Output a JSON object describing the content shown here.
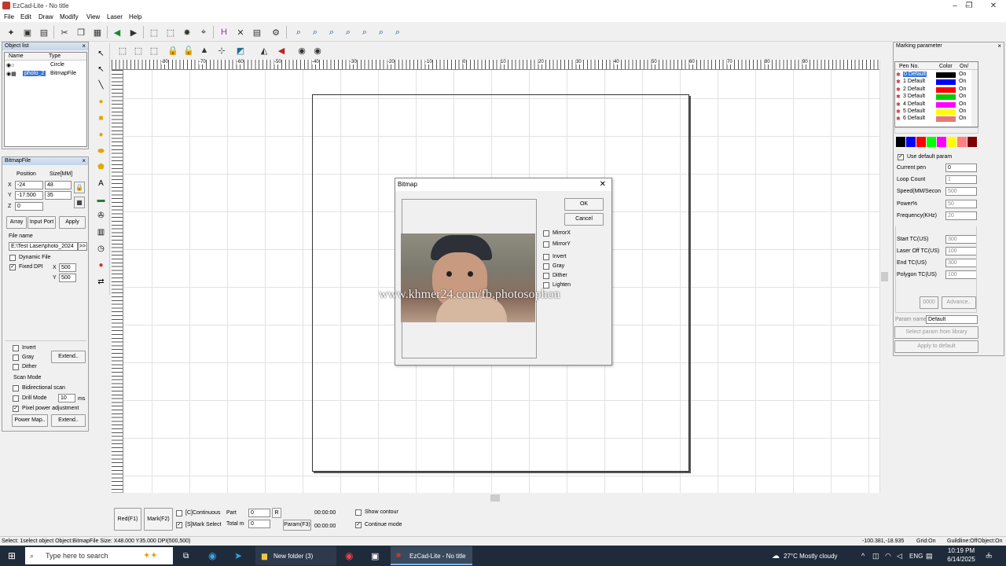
{
  "window": {
    "title": "EzCad-Lite - No title",
    "minimize": "–",
    "maximize": "❐",
    "close": "✕"
  },
  "menu": [
    "File",
    "Edit",
    "Draw",
    "Modify",
    "View",
    "Laser",
    "Help"
  ],
  "object_list": {
    "title": "Object list",
    "col_name": "Name",
    "col_type": "Type",
    "rows": [
      {
        "name": "",
        "type": "Circle"
      },
      {
        "name": "photo_2",
        "type": "BitmapFile"
      }
    ]
  },
  "bitmap_panel": {
    "title": "BitmapFile",
    "position_label": "Position",
    "size_label": "Size[MM]",
    "x_label": "X",
    "y_label": "Y",
    "z_label": "Z",
    "x_pos": "-24",
    "y_pos": "-17.500",
    "z_pos": "0",
    "width": "48",
    "height": "35",
    "array_btn": "Array",
    "input_port_btn": "Input Port",
    "apply_btn": "Apply",
    "file_name_label": "File name",
    "file_name": "E:\\Test Laser\\photo_2024",
    "browse_btn": ">>",
    "dynamic_file": "Dynamic File",
    "fixed_dpi": "Fixed DPI",
    "dpi_x": "500",
    "dpi_y": "500",
    "invert": "Invert",
    "gray": "Gray",
    "dither": "Dither",
    "extend_btn": "Extend..",
    "scan_mode": "Scan Mode",
    "bidirectional": "Bidirectional scan",
    "drill_mode": "Drill Mode",
    "drill_value": "10",
    "drill_unit": "ms",
    "pixel_power": "Pixel power adjustment",
    "power_map_btn": "Power Map..",
    "extend_btn2": "Extend.."
  },
  "ruler_labels": [
    "-80",
    "-70",
    "-60",
    "-50",
    "-40",
    "-30",
    "-20",
    "-10",
    "0",
    "10",
    "20",
    "30",
    "40",
    "50",
    "60",
    "70",
    "80",
    "90"
  ],
  "bitmap_dialog": {
    "title": "Bitmap",
    "ok": "OK",
    "cancel": "Cancel",
    "mirror_x": "MirrorX",
    "mirror_y": "MirrorY",
    "invert": "Invert",
    "gray": "Gray",
    "dither": "Dither",
    "lighten": "Lighten",
    "watermark": "www.khmer24.com/fb.photosophon"
  },
  "marking": {
    "title": "Marking parameter",
    "col_pen": "Pen No.",
    "col_color": "Color",
    "col_on": "On/",
    "pens": [
      {
        "name": "0 Default",
        "color": "#000000",
        "on": "On"
      },
      {
        "name": "1 Default",
        "color": "#0000ff",
        "on": "On"
      },
      {
        "name": "2 Default",
        "color": "#ff0000",
        "on": "On"
      },
      {
        "name": "3 Default",
        "color": "#00cc00",
        "on": "On"
      },
      {
        "name": "4 Default",
        "color": "#ff00ff",
        "on": "On"
      },
      {
        "name": "5 Default",
        "color": "#ffff00",
        "on": "On"
      },
      {
        "name": "6 Default",
        "color": "#e87878",
        "on": "On"
      }
    ],
    "palette": [
      "#000000",
      "#0000ff",
      "#ff0000",
      "#00ff00",
      "#ff00ff",
      "#ffff00",
      "#ff8080",
      "#800000"
    ],
    "use_default": "Use default param",
    "current_pen_label": "Current pen",
    "current_pen": "0",
    "loop_count_label": "Loop Count",
    "loop_count": "1",
    "speed_label": "Speed(MM/Secon",
    "speed": "500",
    "power_label": "Power%",
    "power": "50",
    "frequency_label": "Frequency(KHz)",
    "frequency": "20",
    "start_tc_label": "Start TC(US)",
    "start_tc": "300",
    "laser_off_tc_label": "Laser Off TC(US)",
    "laser_off_tc": "100",
    "end_tc_label": "End TC(US)",
    "end_tc": "300",
    "polygon_tc_label": "Polygon TC(US)",
    "polygon_tc": "100",
    "small_btn": "0000",
    "advance_btn": "Advance..",
    "param_name_label": "Param name",
    "param_name": "Default",
    "select_lib_btn": "Select param from library",
    "apply_default_btn": "Apply to default"
  },
  "bottom": {
    "red_btn": "Red(F1)",
    "mark_btn": "Mark(F2)",
    "continuous": "[C]Continuous",
    "mark_select": "[S]Mark Select",
    "part_label": "Part",
    "part_value": "0",
    "r_btn": "R",
    "total_label": "Total m",
    "total_value": "0",
    "time1": "00:00:00",
    "time2": "00:00:00",
    "param_btn": "Param(F3)",
    "show_contour": "Show contour",
    "continue_mode": "Continue mode"
  },
  "status": {
    "left": "Select: 1select object Object:BitmapFile Size: X48.000 Y35.000 DPI(500,500)",
    "coords": "-100.381,-18.935",
    "grid": "Grid:On",
    "guideline": "Guildline:Off",
    "object": "Object:On"
  },
  "taskbar": {
    "search": "Type here to search",
    "app1": "New folder (3)",
    "app2": "EzCad-Lite - No title",
    "weather": "27°C  Mostly cloudy",
    "lang": "ENG",
    "time": "10:19 PM",
    "date": "6/14/2025",
    "notif": "5"
  }
}
